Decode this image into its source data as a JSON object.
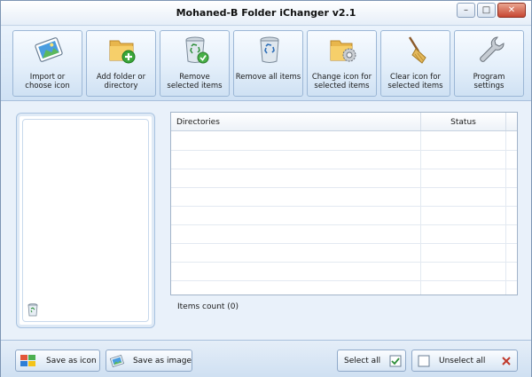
{
  "window": {
    "title": "Mohaned-B Folder iChanger v2.1",
    "controls": {
      "minimize": "–",
      "maximize": "□",
      "close": "✕"
    }
  },
  "toolbar": {
    "buttons": [
      {
        "label": "Import or\nchoose icon",
        "icon": "image-import-icon"
      },
      {
        "label": "Add folder or\ndirectory",
        "icon": "folder-add-icon"
      },
      {
        "label": "Remove\nselected items",
        "icon": "recycle-bin-check-icon"
      },
      {
        "label": "Remove all items",
        "icon": "recycle-bin-icon"
      },
      {
        "label": "Change icon for\nselected items",
        "icon": "folder-gear-icon"
      },
      {
        "label": "Clear icon for\nselected items",
        "icon": "broom-icon"
      },
      {
        "label": "Program\nsettings",
        "icon": "wrench-icon"
      }
    ]
  },
  "table": {
    "columns": [
      "Directories",
      "Status"
    ],
    "rows": []
  },
  "items_count": "Items count (0)",
  "statusbar": {
    "save_as_icon": "Save as icon",
    "save_as_image": "Save as image",
    "select_all": "Select all",
    "unselect_all": "Unselect all"
  },
  "colors": {
    "accent": "#9cb7d6",
    "close_button": "#c74632",
    "window_bg": "#e9f1fa"
  }
}
